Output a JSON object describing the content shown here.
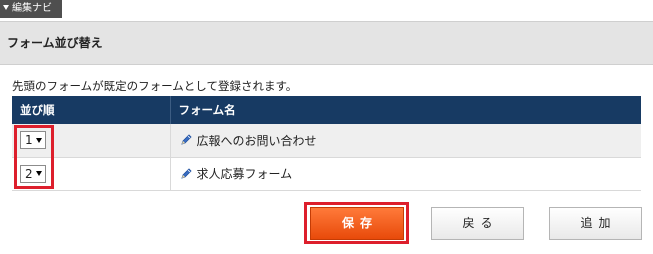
{
  "edit_nav": {
    "label": "編集ナビ"
  },
  "page": {
    "title": "フォーム並び替え"
  },
  "notice": "先頭のフォームが既定のフォームとして登録されます。",
  "table": {
    "headers": {
      "order": "並び順",
      "form_name": "フォーム名"
    },
    "rows": [
      {
        "order": "1",
        "form_name": "広報へのお問い合わせ"
      },
      {
        "order": "2",
        "form_name": "求人応募フォーム"
      }
    ]
  },
  "buttons": {
    "save": "保存",
    "back": "戻る",
    "add": "追加"
  },
  "colors": {
    "header_bg": "#173a63",
    "save_bg": "#e84a0a",
    "highlight": "#dd1f2c"
  },
  "icons": {
    "edit": "pencil-icon",
    "nav_toggle": "triangle-down-icon",
    "select_caret": "caret-down-icon"
  }
}
